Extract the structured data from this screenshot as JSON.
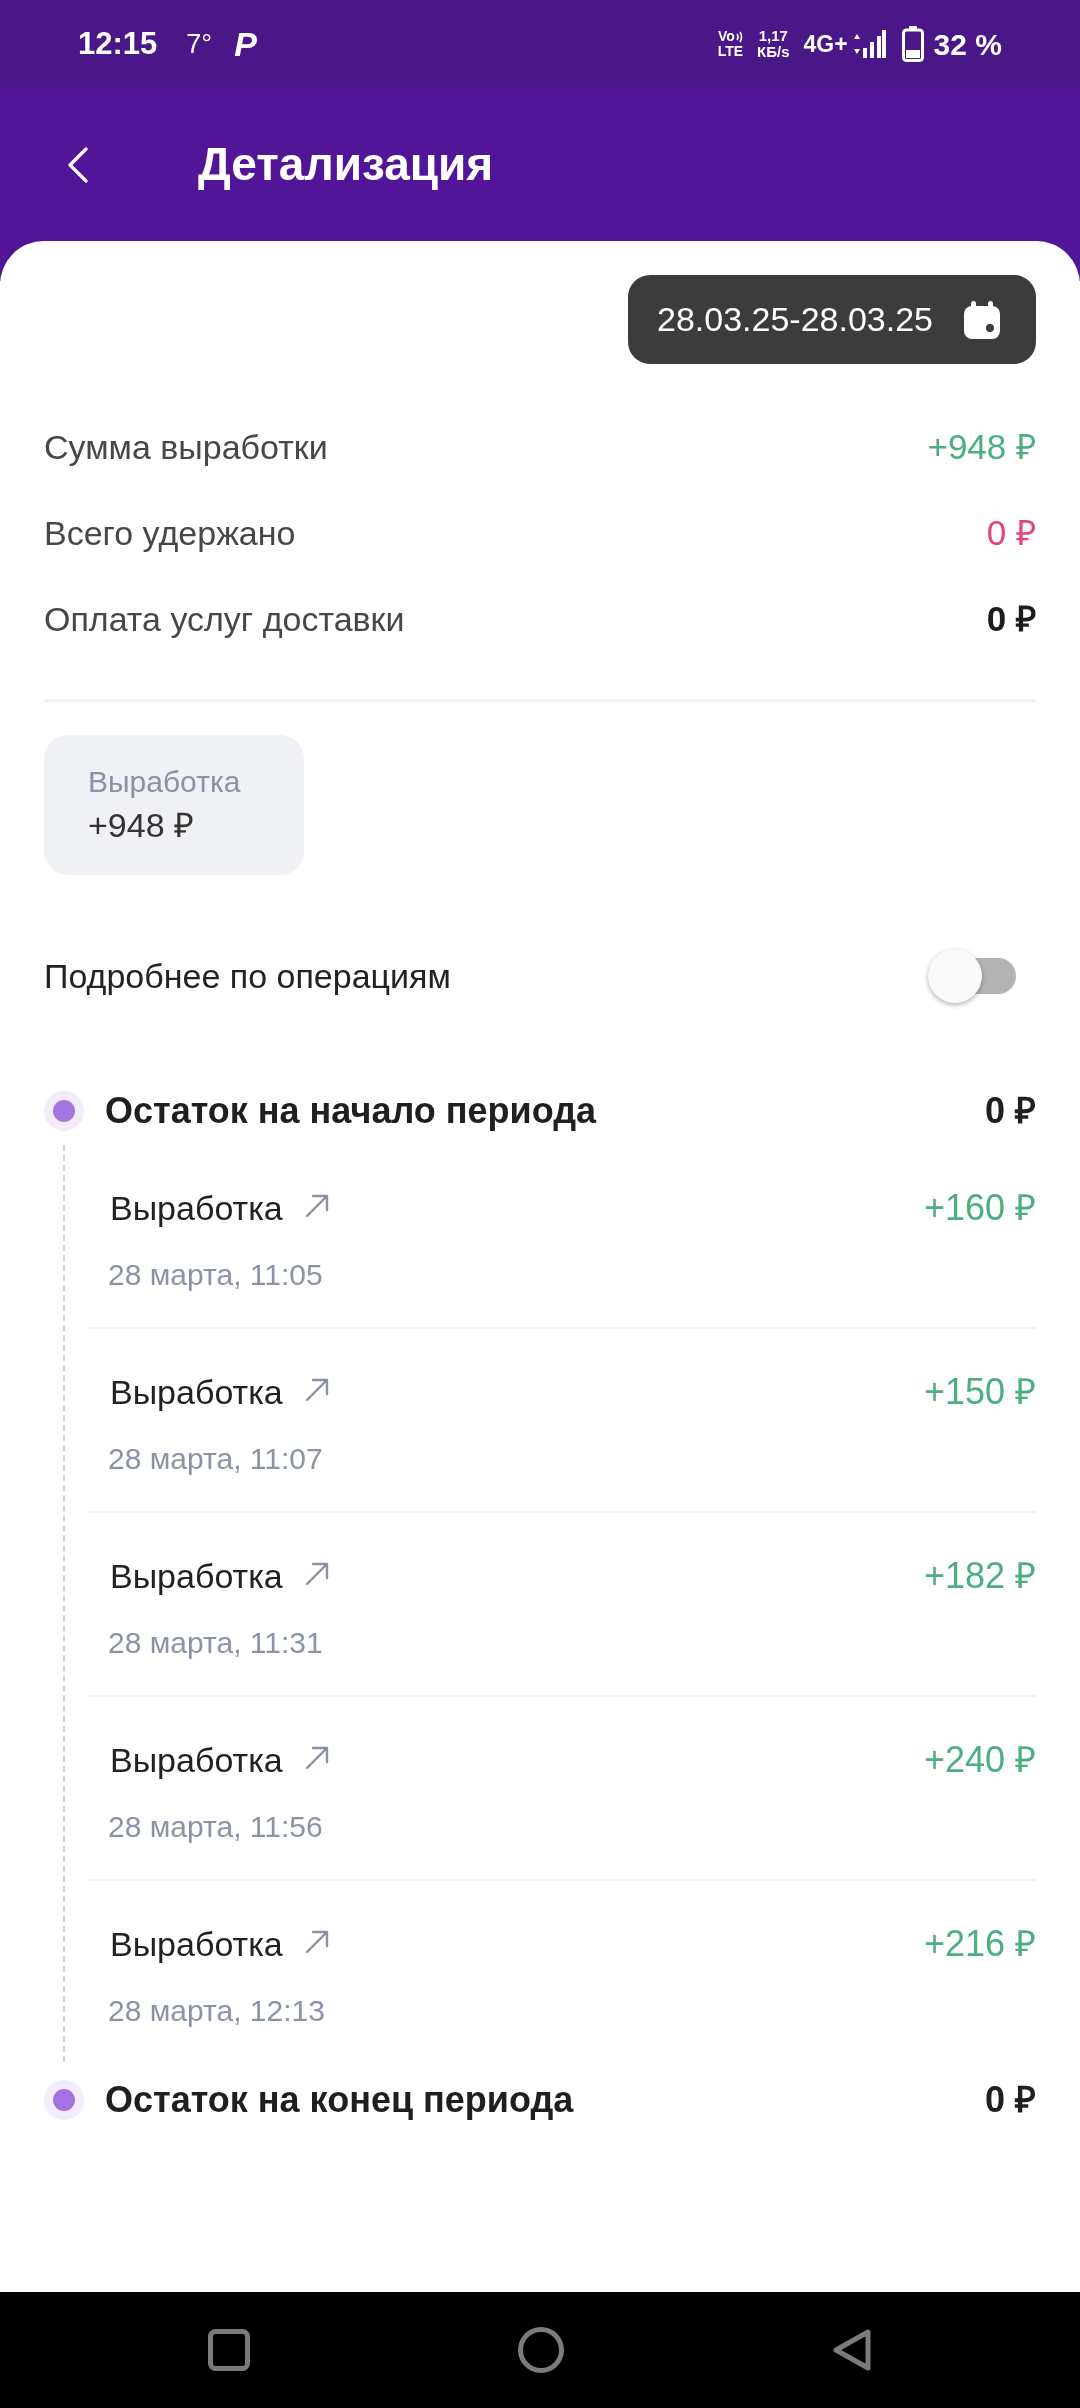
{
  "status_bar": {
    "time": "12:15",
    "temperature": "7°",
    "app_glyph": "P",
    "volte": [
      "Vo",
      "LTE"
    ],
    "data_speed": [
      "1,17",
      "КБ/s"
    ],
    "network": "4G+",
    "battery": "32 %"
  },
  "header": {
    "title": "Детализация"
  },
  "period": {
    "label": "28.03.25-28.03.25"
  },
  "summary": [
    {
      "label": "Сумма выработки",
      "value": "+948 ₽",
      "kind": "income"
    },
    {
      "label": "Всего удержано",
      "value": "0 ₽",
      "kind": "deduction"
    },
    {
      "label": "Оплата услуг доставки",
      "value": "0 ₽",
      "kind": "payout"
    }
  ],
  "categories": [
    {
      "label": "Выработка",
      "value": "+948 ₽"
    }
  ],
  "details_toggle": {
    "label": "Подробнее по операциям",
    "on": false
  },
  "timeline": {
    "opening": {
      "label": "Остаток на начало периода",
      "value": "0 ₽"
    },
    "operations": [
      {
        "title": "Выработка",
        "amount": "+160 ₽",
        "date": "28 марта, 11:05"
      },
      {
        "title": "Выработка",
        "amount": "+150 ₽",
        "date": "28 марта, 11:07"
      },
      {
        "title": "Выработка",
        "amount": "+182 ₽",
        "date": "28 марта, 11:31"
      },
      {
        "title": "Выработка",
        "amount": "+240 ₽",
        "date": "28 марта, 11:56"
      },
      {
        "title": "Выработка",
        "amount": "+216 ₽",
        "date": "28 марта, 12:13"
      }
    ],
    "closing": {
      "label": "Остаток на конец периода",
      "value": "0 ₽"
    }
  }
}
